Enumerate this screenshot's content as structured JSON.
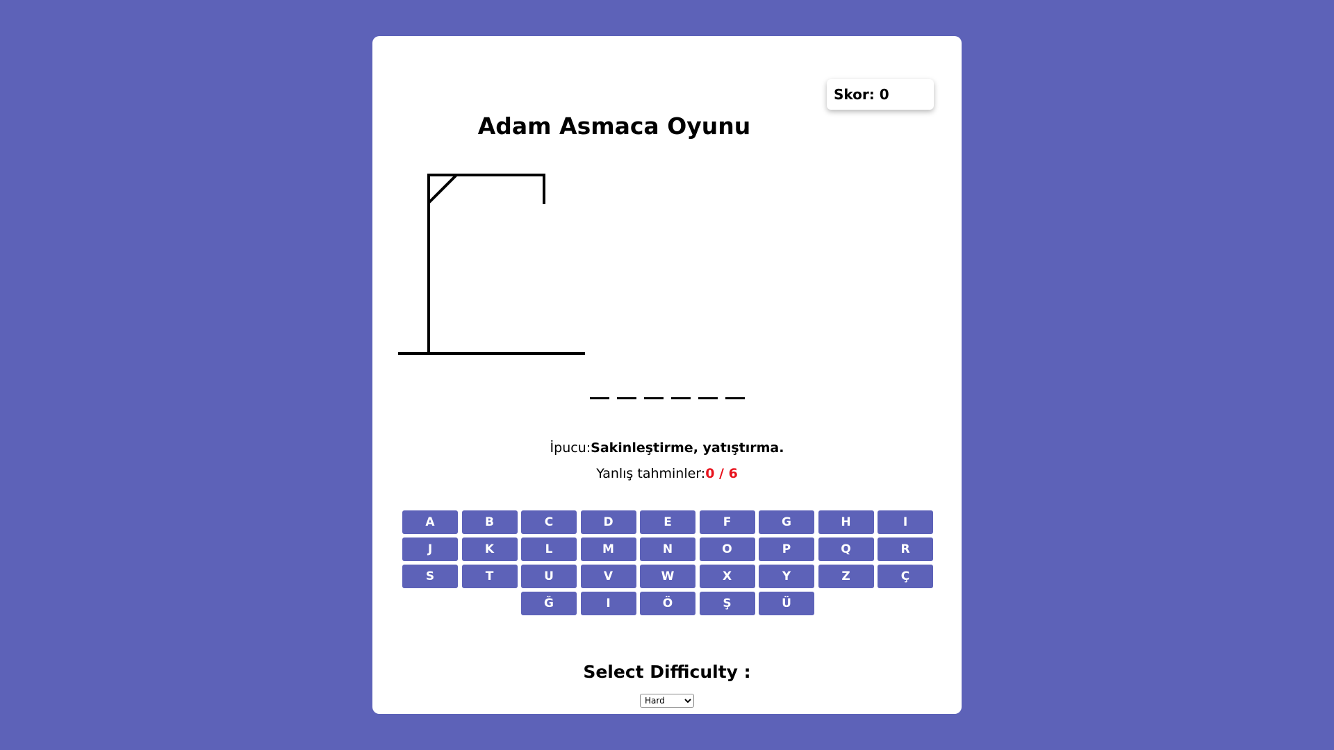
{
  "game": {
    "title": "Adam Asmaca Oyunu",
    "score_label": "Skor: 0",
    "word_length": 6,
    "hint_prefix": "İpucu:",
    "hint_text": "Sakinleştirme, yatıştırma.",
    "wrong_prefix": "Yanlış tahminler:",
    "wrong_count": "0 / 6",
    "wrong_guesses": 0,
    "max_wrong": 6
  },
  "keyboard": {
    "keys": [
      "A",
      "B",
      "C",
      "D",
      "E",
      "F",
      "G",
      "H",
      "I",
      "J",
      "K",
      "L",
      "M",
      "N",
      "O",
      "P",
      "Q",
      "R",
      "S",
      "T",
      "U",
      "V",
      "W",
      "X",
      "Y",
      "Z",
      "Ç",
      "Ğ",
      "I",
      "Ö",
      "Ş",
      "Ü"
    ]
  },
  "difficulty": {
    "label": "Select Difficulty :",
    "selected": "Hard",
    "options": [
      "Hard"
    ]
  },
  "colors": {
    "background": "#5d62b8",
    "key": "#5d62b8",
    "wrong_count": "#e8131d"
  }
}
